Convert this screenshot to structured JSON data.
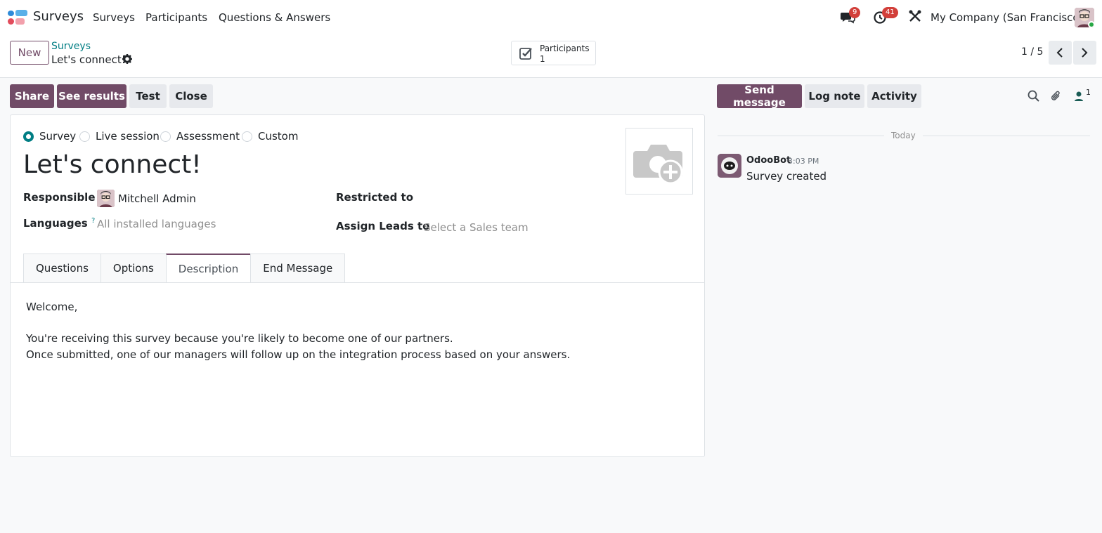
{
  "navbar": {
    "app_name": "Surveys",
    "menu": [
      "Surveys",
      "Participants",
      "Questions & Answers"
    ],
    "messages_badge": "9",
    "activities_badge": "41",
    "company": "My Company (San Francisco)"
  },
  "control": {
    "new_label": "New",
    "breadcrumb_parent": "Surveys",
    "breadcrumb_current": "Let's connect!",
    "smart_button": {
      "label": "Participants",
      "value": "1"
    },
    "pager": "1 / 5"
  },
  "actions": {
    "share": "Share",
    "see_results": "See results",
    "test": "Test",
    "close": "Close"
  },
  "form": {
    "survey_types": [
      "Survey",
      "Live session",
      "Assessment",
      "Custom"
    ],
    "selected_type": "Survey",
    "title": "Let's connect!",
    "responsible_label": "Responsible",
    "responsible_value": "Mitchell Admin",
    "languages_label": "Languages",
    "languages_help": "?",
    "languages_placeholder": "All installed languages",
    "restricted_label": "Restricted to",
    "assign_leads_label": "Assign Leads to",
    "assign_leads_placeholder": "Select a Sales team",
    "tabs": [
      "Questions",
      "Options",
      "Description",
      "End Message"
    ],
    "active_tab": "Description",
    "description": [
      "Welcome,",
      "",
      "You're receiving this survey because you're likely to become one of our partners.",
      "Once submitted, one of our managers will follow up on the integration process based on your answers."
    ]
  },
  "chatter": {
    "send_message": "Send message",
    "log_note": "Log note",
    "activity": "Activity",
    "followers_count": "1",
    "date_separator": "Today",
    "messages": [
      {
        "author": "OdooBot",
        "time": "3:03 PM",
        "body": "Survey created"
      }
    ]
  },
  "colors": {
    "primary": "#714b67",
    "teal": "#017e84",
    "badge": "#d23f3a"
  }
}
